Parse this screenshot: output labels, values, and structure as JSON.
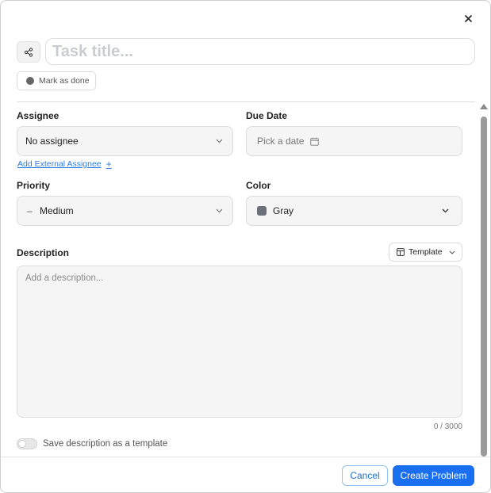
{
  "header": {
    "title_placeholder": "Task title...",
    "mark_done_label": "Mark as done"
  },
  "fields": {
    "assignee": {
      "label": "Assignee",
      "value": "No assignee"
    },
    "add_external_label": "Add External Assignee",
    "add_external_plus": "+",
    "due_date": {
      "label": "Due Date",
      "placeholder": "Pick a date"
    },
    "priority": {
      "label": "Priority",
      "value": "Medium",
      "icon_glyph": "–"
    },
    "color": {
      "label": "Color",
      "value": "Gray",
      "swatch": "#6b7079"
    }
  },
  "description": {
    "label": "Description",
    "template_label": "Template",
    "placeholder": "Add a description...",
    "counter": "0 / 3000",
    "save_template_label": "Save description as a template"
  },
  "footer": {
    "cancel_label": "Cancel",
    "create_label": "Create Problem"
  },
  "colors": {
    "accent": "#1a6ff0",
    "link": "#2b7de0"
  }
}
